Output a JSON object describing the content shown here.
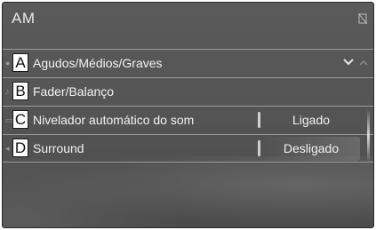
{
  "header": {
    "title": "AM",
    "corner_icon": "signal-off-icon"
  },
  "menu": {
    "items": [
      {
        "letter": "A",
        "label": "Agudos/Médios/Graves",
        "icon": "tone-icon",
        "control": "chevron-down-icon"
      },
      {
        "letter": "B",
        "label": "Fader/Balanço",
        "icon": "fader-icon"
      },
      {
        "letter": "C",
        "label": "Nivelador automático do som",
        "icon": "asl-icon",
        "value": "Ligado"
      },
      {
        "letter": "D",
        "label": "Surround",
        "icon": "surround-icon",
        "value": "Desligado"
      }
    ]
  },
  "colors": {
    "screen_background": "#555555",
    "text": "#f2f2f2",
    "callout_background": "#ffffff"
  }
}
